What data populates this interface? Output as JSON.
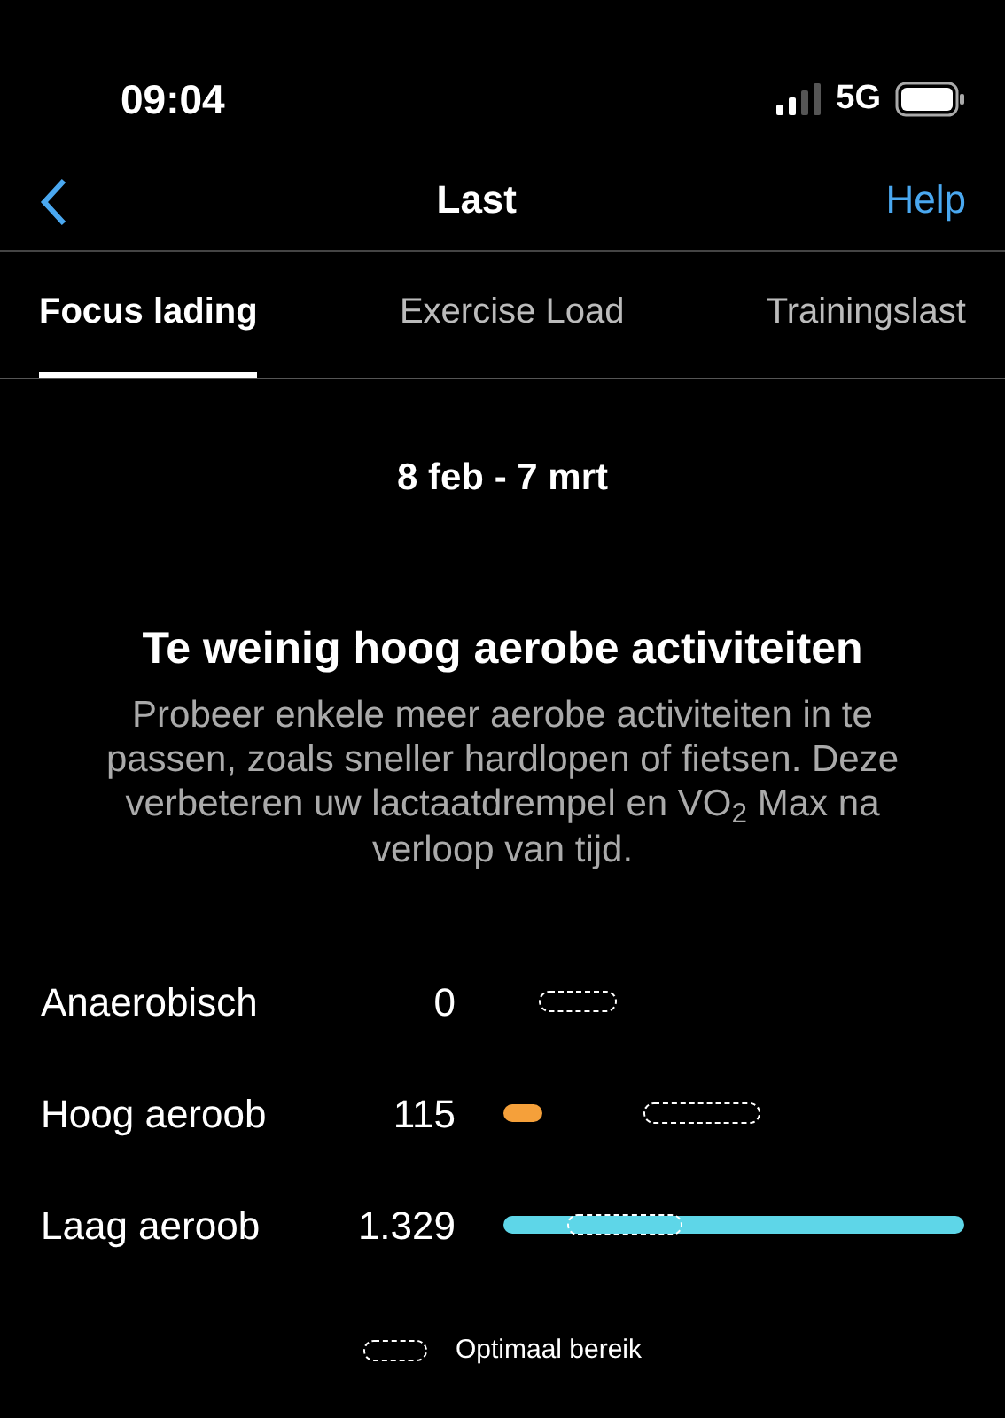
{
  "status_bar": {
    "time": "09:04",
    "network": "5G"
  },
  "nav": {
    "title": "Last",
    "help": "Help"
  },
  "tabs": [
    {
      "label": "Focus lading",
      "selected": true
    },
    {
      "label": "Exercise Load",
      "selected": false
    },
    {
      "label": "Trainingslast",
      "selected": false
    }
  ],
  "date_range": "8 feb - 7 mrt",
  "heading": "Te weinig hoog aerobe activiteiten",
  "message": "Probeer enkele meer aerobe activiteiten in te passen, zoals sneller hardlopen of fietsen. Deze verbeteren uw lactaatdrempel en VO$_{2}$ Max na verloop van tijd.",
  "rows": [
    {
      "label": "Anaerobisch",
      "value": "0"
    },
    {
      "label": "Hoog aeroob",
      "value": "115",
      "color": "#f5a03a"
    },
    {
      "label": "Laag aeroob",
      "value": "1.329",
      "color": "#5ed6e8"
    }
  ],
  "legend": "Optimaal bereik"
}
